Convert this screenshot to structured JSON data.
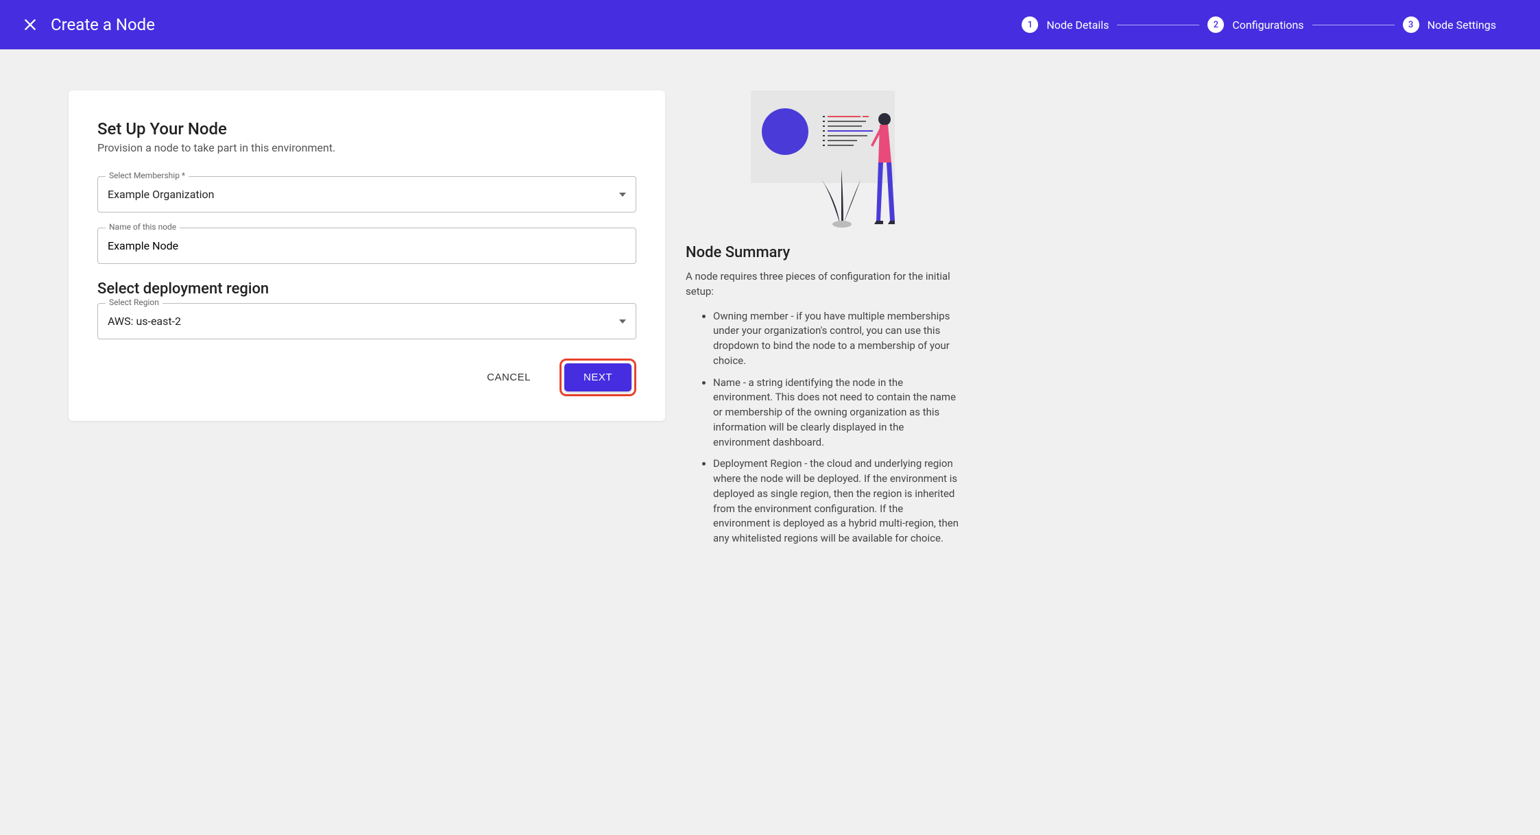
{
  "header": {
    "title": "Create a Node",
    "steps": [
      {
        "num": "1",
        "label": "Node Details"
      },
      {
        "num": "2",
        "label": "Configurations"
      },
      {
        "num": "3",
        "label": "Node Settings"
      }
    ]
  },
  "form": {
    "title": "Set Up Your Node",
    "subtitle": "Provision a node to take part in this environment.",
    "membership": {
      "label": "Select Membership *",
      "value": "Example Organization"
    },
    "nodeName": {
      "label": "Name of this node",
      "value": "Example Node"
    },
    "regionSection": "Select deployment region",
    "region": {
      "label": "Select Region",
      "value": "AWS: us-east-2"
    },
    "cancel": "CANCEL",
    "next": "NEXT"
  },
  "summary": {
    "title": "Node Summary",
    "intro": "A node requires three pieces of configuration for the initial setup:",
    "items": [
      "Owning member - if you have multiple memberships under your organization's control, you can use this dropdown to bind the node to a membership of your choice.",
      "Name - a string identifying the node in the environment. This does not need to contain the name or membership of the owning organization as this information will be clearly displayed in the environment dashboard.",
      "Deployment Region - the cloud and underlying region where the node will be deployed. If the environment is deployed as single region, then the region is inherited from the environment configuration. If the environment is deployed as a hybrid multi-region, then any whitelisted regions will be available for choice."
    ]
  }
}
